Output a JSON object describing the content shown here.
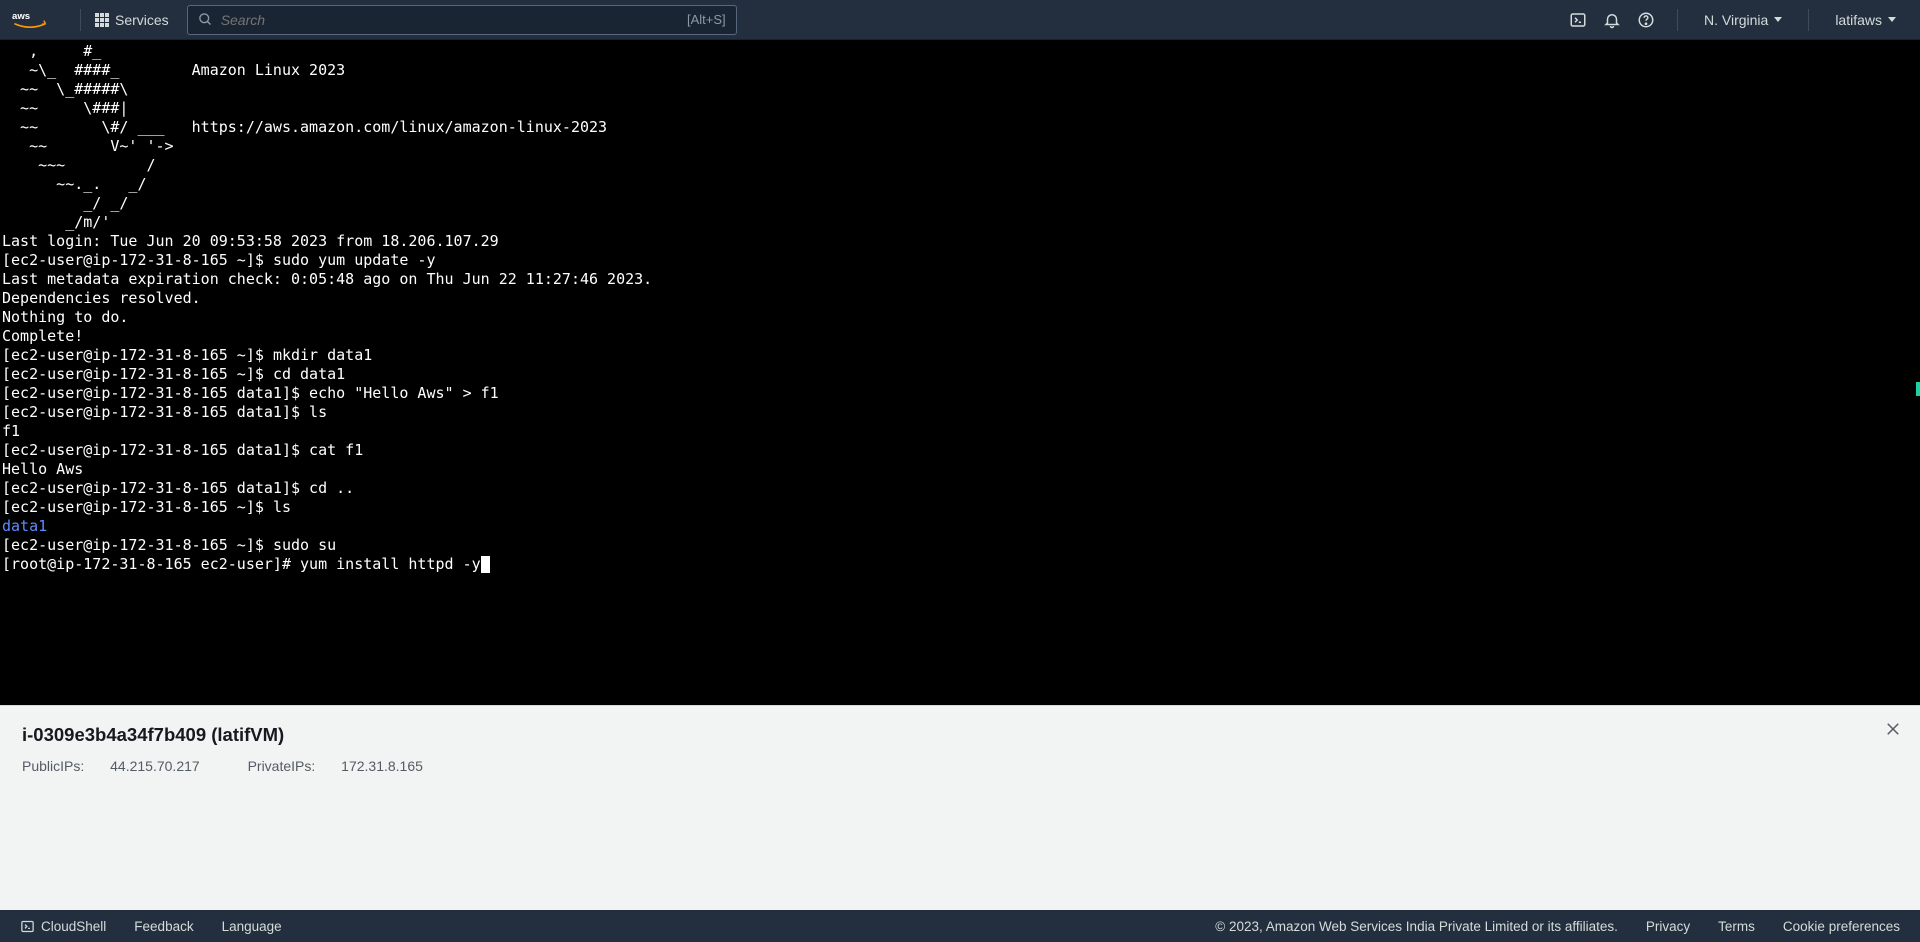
{
  "topbar": {
    "services_label": "Services",
    "search_placeholder": "Search",
    "search_hint": "[Alt+S]",
    "region": "N. Virginia",
    "account": "latifaws"
  },
  "terminal": {
    "motd": "   ,     #_\n   ~\\_  ####_        Amazon Linux 2023\n  ~~  \\_#####\\\n  ~~     \\###|\n  ~~       \\#/ ___   https://aws.amazon.com/linux/amazon-linux-2023\n   ~~       V~' '->\n    ~~~         /\n      ~~._.   _/\n         _/ _/\n       _/m/'",
    "last_login": "Last login: Tue Jun 20 09:53:58 2023 from 18.206.107.29",
    "p_user": "[ec2-user@ip-172-31-8-165 ~]$ ",
    "p_data1": "[ec2-user@ip-172-31-8-165 data1]$ ",
    "p_root": "[root@ip-172-31-8-165 ec2-user]# ",
    "cmd_update": "sudo yum update -y",
    "out_meta": "Last metadata expiration check: 0:05:48 ago on Thu Jun 22 11:27:46 2023.",
    "out_deps": "Dependencies resolved.",
    "out_nothing": "Nothing to do.",
    "out_complete": "Complete!",
    "cmd_mkdir": "mkdir data1",
    "cmd_cd_data1": "cd data1",
    "cmd_echo": "echo \"Hello Aws\" > f1",
    "cmd_ls": "ls",
    "out_f1": "f1",
    "cmd_cat": "cat f1",
    "out_hello": "Hello Aws",
    "cmd_cdup": "cd ..",
    "out_data1": "data1",
    "cmd_sudosu": "sudo su",
    "cmd_install": "yum install httpd -y"
  },
  "info": {
    "title": "i-0309e3b4a34f7b409 (latifVM)",
    "public_label": "PublicIPs: ",
    "public_ip": "44.215.70.217",
    "private_label": "PrivateIPs: ",
    "private_ip": "172.31.8.165"
  },
  "bottombar": {
    "cloudshell": "CloudShell",
    "feedback": "Feedback",
    "language": "Language",
    "copyright": "© 2023, Amazon Web Services India Private Limited or its affiliates.",
    "privacy": "Privacy",
    "terms": "Terms",
    "cookies": "Cookie preferences"
  }
}
